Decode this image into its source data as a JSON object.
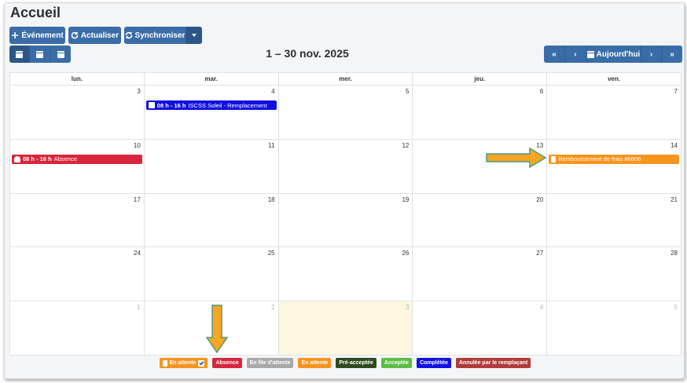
{
  "page": {
    "title": "Accueil"
  },
  "toolbar": {
    "event_label": "Événement",
    "refresh_label": "Actualiser",
    "sync_label": "Synchroniser"
  },
  "range_title": "1 – 30 nov. 2025",
  "nav": {
    "today_label": "Aujourd'hui"
  },
  "weekdays": [
    "lun.",
    "mar.",
    "mer.",
    "jeu.",
    "ven."
  ],
  "weeks": [
    [
      "3",
      "4",
      "5",
      "6",
      "7"
    ],
    [
      "10",
      "11",
      "12",
      "13",
      "14"
    ],
    [
      "17",
      "18",
      "19",
      "20",
      "21"
    ],
    [
      "24",
      "25",
      "26",
      "27",
      "28"
    ],
    [
      "1",
      "2",
      "3",
      "4",
      "5"
    ]
  ],
  "events": [
    {
      "time": "08 h - 16 h",
      "title": "ISCSS Soleil - Remplacement",
      "color": "#1010e0",
      "icon": "chat-icon"
    },
    {
      "time": "08 h - 16 h",
      "title": "Absence",
      "color": "#d7263d",
      "icon": "person-icon"
    },
    {
      "time": "",
      "title": "Remboursement de frais #8606",
      "color": "#f7941d",
      "icon": "document-icon"
    }
  ],
  "legend": [
    {
      "label": "En attente",
      "color": "#f7941d",
      "checked": true
    },
    {
      "label": "Absence",
      "color": "#d7263d"
    },
    {
      "label": "En file d'attente",
      "color": "#a9a9a9"
    },
    {
      "label": "En attente",
      "color": "#f7941d"
    },
    {
      "label": "Pré-acceptée",
      "color": "#2e4a1e"
    },
    {
      "label": "Acceptée",
      "color": "#5dbb46"
    },
    {
      "label": "Complétée",
      "color": "#1010e0"
    },
    {
      "label": "Annulée par le remplaçant",
      "color": "#b03a3a"
    }
  ],
  "colors": {
    "primary": "#3a6da7",
    "today_bg": "#fdf7df",
    "annotation_arrow": "#f5a623"
  }
}
